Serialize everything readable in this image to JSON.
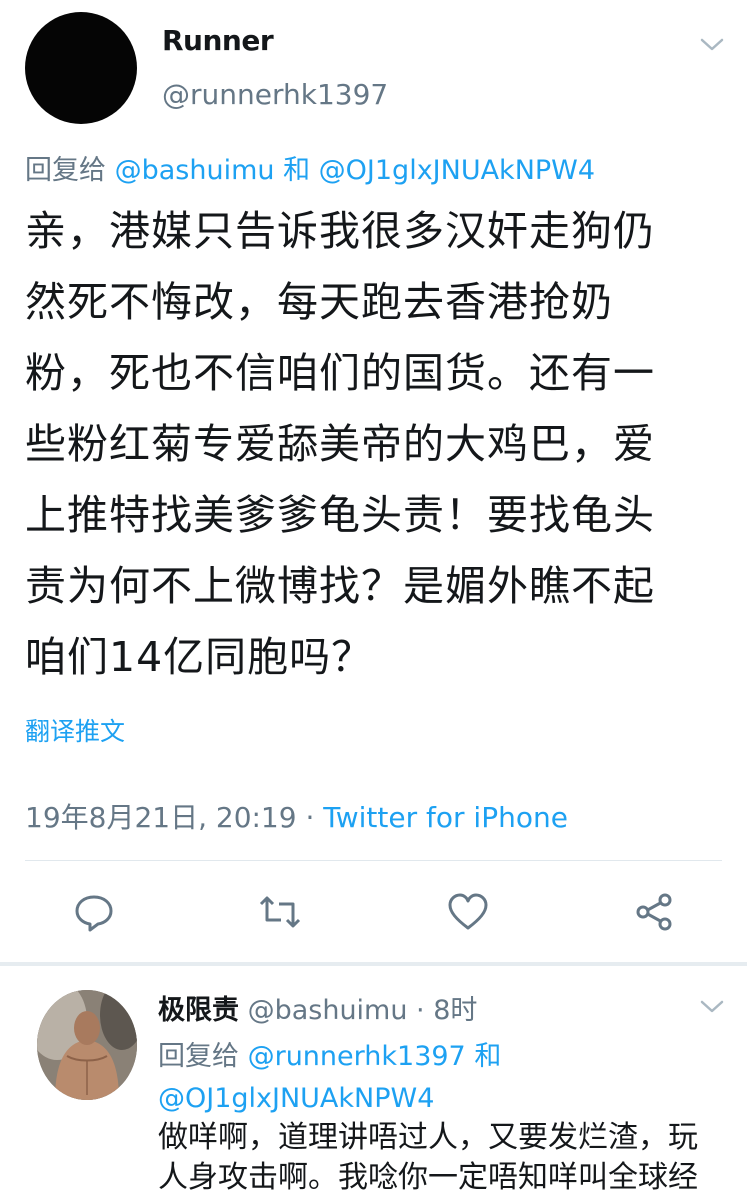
{
  "main_tweet": {
    "display_name": "Runner",
    "handle": "@runnerhk1397",
    "reply_prefix": "回复给 ",
    "reply_user_1": "@bashuimu",
    "reply_and": " 和 ",
    "reply_user_2": "@OJ1glxJNUAkNPW4",
    "text_lines": [
      "亲，港媒只告诉我很多汉奸走狗仍",
      "然死不悔改，每天跑去香港抢奶",
      "粉，死也不信咱们的国货。还有一",
      "些粉红菊专爱舔美帝的大鸡巴，爱",
      "上推特找美爹爹龟头责！要找龟头",
      "责为何不上微博找？是媚外瞧不起",
      "咱们14亿同胞吗？"
    ],
    "translate_label": "翻译推文",
    "timestamp": "19年8月21日, 20:19",
    "separator": " · ",
    "source": "Twitter for iPhone"
  },
  "actions": {
    "reply_icon": "reply-bubble-icon",
    "retweet_icon": "retweet-icon",
    "like_icon": "heart-icon",
    "share_icon": "share-icon"
  },
  "reply_tweet": {
    "display_name": "极限责",
    "handle_time": " @bashuimu · 8时",
    "reply_prefix": "回复给 ",
    "reply_user_1": "@runnerhk1397",
    "reply_and": " 和",
    "reply_user_2": "@OJ1glxJNUAkNPW4",
    "text_lines": [
      "做咩啊，道理讲唔过人，又要发烂渣，玩",
      "人身攻击啊。我唸你一定唔知咩叫全球经"
    ]
  },
  "colors": {
    "link": "#1da1f2",
    "secondary_text": "#657786",
    "primary_text": "#14171a",
    "divider": "#e1e8ed"
  }
}
